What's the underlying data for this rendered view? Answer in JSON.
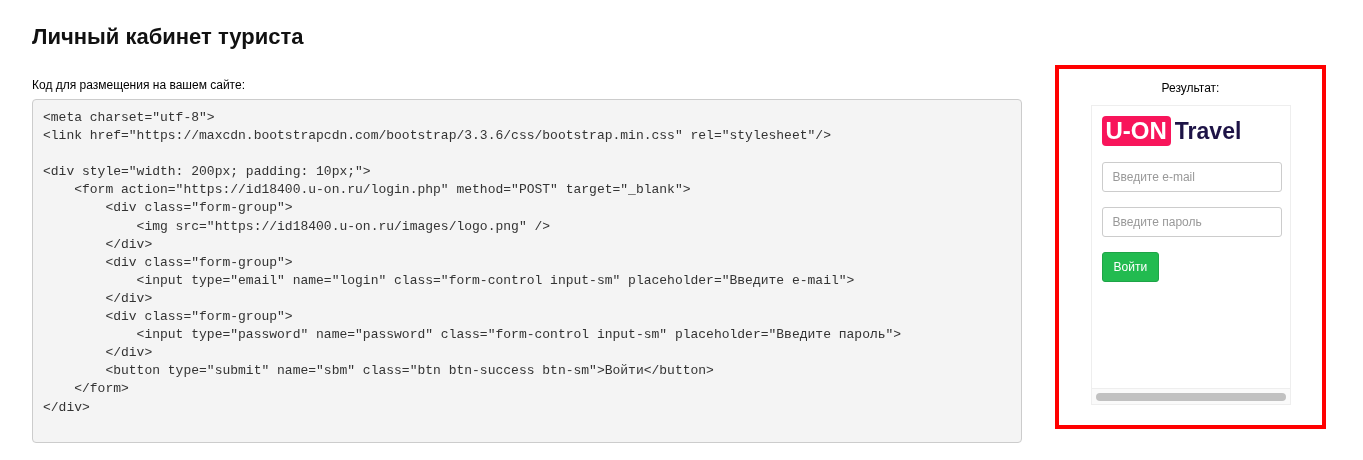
{
  "page": {
    "title": "Личный кабинет туриста"
  },
  "code_section": {
    "label": "Код для размещения на вашем сайте:",
    "code": "<meta charset=\"utf-8\">\n<link href=\"https://maxcdn.bootstrapcdn.com/bootstrap/3.3.6/css/bootstrap.min.css\" rel=\"stylesheet\"/>\n\n<div style=\"width: 200px; padding: 10px;\">\n    <form action=\"https://id18400.u-on.ru/login.php\" method=\"POST\" target=\"_blank\">\n        <div class=\"form-group\">\n            <img src=\"https://id18400.u-on.ru/images/logo.png\" />\n        </div>\n        <div class=\"form-group\">\n            <input type=\"email\" name=\"login\" class=\"form-control input-sm\" placeholder=\"Введите e-mail\">\n        </div>\n        <div class=\"form-group\">\n            <input type=\"password\" name=\"password\" class=\"form-control input-sm\" placeholder=\"Введите пароль\">\n        </div>\n        <button type=\"submit\" name=\"sbm\" class=\"btn btn-success btn-sm\">Войти</button>\n    </form>\n</div>"
  },
  "result": {
    "label": "Результат:",
    "logo": {
      "badge": "U-ON",
      "word": "Travel"
    },
    "fields": [
      {
        "placeholder": "Введите e-mail"
      },
      {
        "placeholder": "Введите пароль"
      }
    ],
    "button": "Войти"
  }
}
